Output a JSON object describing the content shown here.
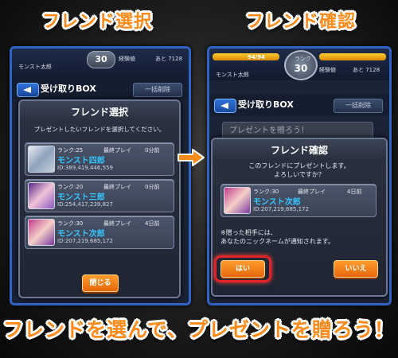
{
  "headings": {
    "left": "フレンド選択",
    "right": "フレンド確認"
  },
  "footer": "フレンドを選んで、プレゼントを贈ろう！",
  "left_panel": {
    "player_name": "モンスト太郎",
    "rank_value": "30",
    "exp_label": "経験値",
    "exp_remaining": "あと 7128",
    "box_title": "受け取りBOX",
    "bulk_delete": "一括削除",
    "dialog": {
      "title": "フレンド選択",
      "message": "プレゼントしたいフレンドを選択してください。",
      "friends": [
        {
          "rank": "ランク:25",
          "last_play_label": "最終プレイ",
          "last_play": "0分前",
          "name": "モンスト四郎",
          "id": "ID:389,419,446,559"
        },
        {
          "rank": "ランク:20",
          "last_play_label": "最終プレイ",
          "last_play": "0分前",
          "name": "モンスト三郎",
          "id": "ID:254,417,239,827"
        },
        {
          "rank": "ランク:30",
          "last_play_label": "最終プレイ",
          "last_play": "4日前",
          "name": "モンスト次郎",
          "id": "ID:207,219,685,172"
        }
      ],
      "close_button": "閉じる"
    }
  },
  "right_panel": {
    "hp_text": "94/94",
    "rank_label": "ランク",
    "rank_value": "30",
    "player_name": "モンスト太郎",
    "exp_label": "経験値",
    "exp_remaining": "あと 7128",
    "box_title": "受け取りBOX",
    "bulk_delete": "一括削除",
    "behind_text": "プレゼントを贈ろう！",
    "dialog": {
      "title": "フレンド確認",
      "message_line1": "このフレンドにプレゼントします。",
      "message_line2": "よろしいですか？",
      "friend": {
        "rank": "ランク:30",
        "last_play_label": "最終プレイ",
        "last_play": "4日前",
        "name": "モンスト次郎",
        "id": "ID:207,219,685,172"
      },
      "note_line1": "※贈った相手には、",
      "note_line2": "あなたのニックネームが通知されます。",
      "yes_button": "はい",
      "no_button": "いいえ"
    }
  },
  "colors": {
    "accent": "#ff8a1a",
    "name_blue": "#35c6ff",
    "highlight_red": "#e2232a",
    "panel_border": "#2f63c4"
  }
}
